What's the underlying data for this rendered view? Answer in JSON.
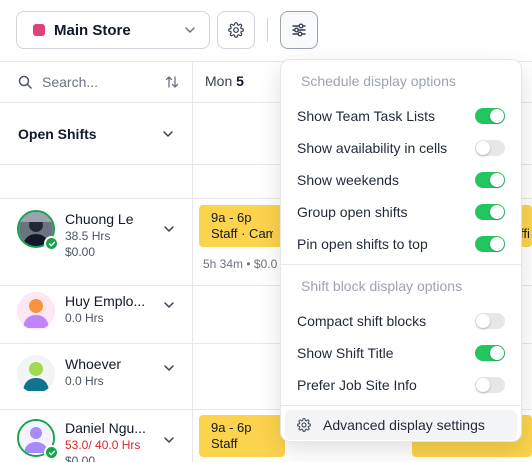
{
  "toolbar": {
    "store_name": "Main Store",
    "store_color": "#e0417a",
    "settings_icon": "gear-icon",
    "display_icon": "sliders-icon"
  },
  "grid": {
    "search_placeholder": "Search...",
    "day_name": "Mon",
    "day_number": "5",
    "open_shifts_label": "Open Shifts"
  },
  "people": [
    {
      "name": "Chuong Le",
      "hours": "38.5 Hrs",
      "pay": "$0.00",
      "verified": true
    },
    {
      "name": "Huy Emplo...",
      "hours": "0.0 Hrs"
    },
    {
      "name": "Whoever",
      "hours": "0.0 Hrs"
    },
    {
      "name": "Daniel Ngu...",
      "hours": "53.0/ 40.0 Hrs",
      "pay": "$0.00",
      "hours_over": true,
      "verified": true
    }
  ],
  "shifts": [
    {
      "time": "9a - 6p",
      "role": "Staff · Came",
      "meta": "5h 34m • $0.0",
      "overflow_label": "ffi"
    },
    {
      "time": "9a - 6p",
      "role": "Staff"
    }
  ],
  "menu": {
    "section1_title": "Schedule display options",
    "section1_items": [
      {
        "label": "Show Team Task Lists",
        "on": true
      },
      {
        "label": "Show availability in cells",
        "on": false
      },
      {
        "label": "Show weekends",
        "on": true
      },
      {
        "label": "Group open shifts",
        "on": true
      },
      {
        "label": "Pin open shifts to top",
        "on": true
      }
    ],
    "section2_title": "Shift block display options",
    "section2_items": [
      {
        "label": "Compact shift blocks",
        "on": false
      },
      {
        "label": "Show Shift Title",
        "on": true
      },
      {
        "label": "Prefer Job Site Info",
        "on": false
      }
    ],
    "advanced_label": "Advanced display settings"
  },
  "colors": {
    "shift_yellow": "#fcd34d",
    "toggle_on": "#22c55e",
    "over_hours": "#dc2626"
  }
}
